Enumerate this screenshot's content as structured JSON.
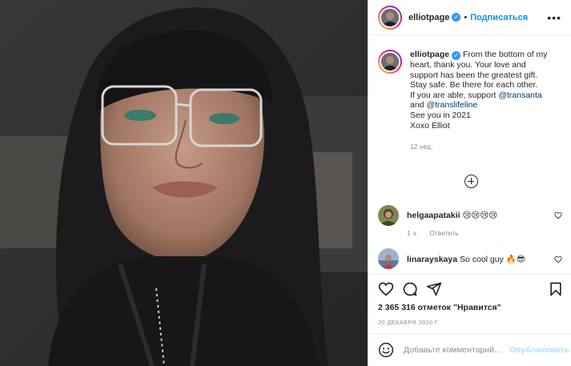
{
  "post": {
    "author": "elliotpage",
    "follow_label": "Подписаться",
    "more_label": "•••",
    "caption_lines": [
      "From the bottom of my",
      "heart, thank you. Your love and",
      "support has been the greatest gift.",
      "Stay safe. Be there for each other.",
      "If you are able, support",
      "and",
      "See you in 2021",
      "Xoxo Elliot"
    ],
    "mention_1": "@transanta",
    "mention_2": "@translifeline",
    "caption_age": "12 нед.",
    "likes_text": "2 365 316 отметок \"Нравится\"",
    "date_text": "20 ДЕКАБРЯ 2020 Г."
  },
  "comments": [
    {
      "user": "helgaapatakii",
      "text": "😢😢😢😢",
      "time": "1 ч.",
      "reply": "Ответить"
    },
    {
      "user": "linarayskaya",
      "text": "So cool guy 🔥😎"
    }
  ],
  "composer": {
    "placeholder": "Добавьте комментарий...",
    "publish_label": "Опубликовать"
  },
  "colors": {
    "accent": "#0095f6",
    "link": "#00376b",
    "verified": "#3897f0",
    "muted": "#8e8e8e"
  },
  "icons": [
    "verified-badge-icon",
    "more-options-icon",
    "load-more-comments-icon",
    "heart-icon",
    "comment-icon",
    "share-icon",
    "bookmark-icon",
    "emoji-icon"
  ]
}
